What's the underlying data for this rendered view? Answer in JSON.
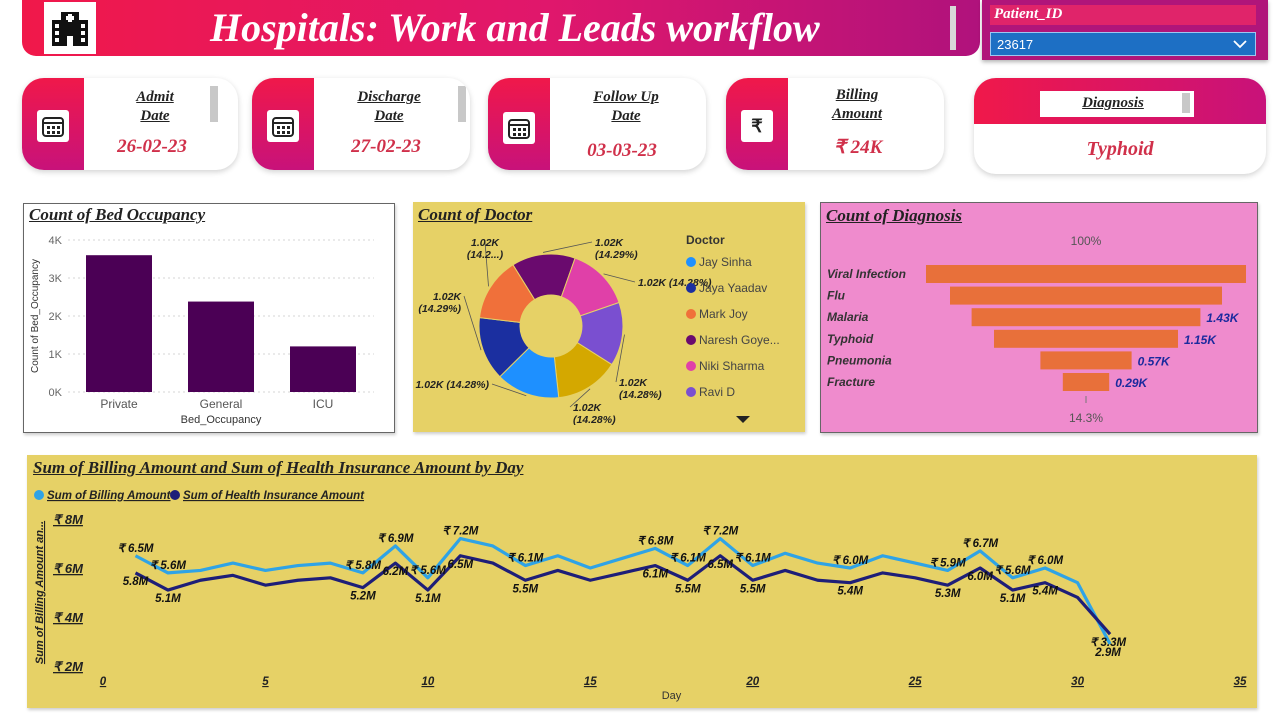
{
  "header": {
    "title": "Hospitals: Work and Leads workflow",
    "logo_icon": "hospital-icon"
  },
  "slicer": {
    "label": "Patient_ID",
    "value": "23617"
  },
  "kpis": [
    {
      "label_line1": "Admit",
      "label_line2": "Date",
      "value": "26-02-23",
      "icon": "calendar-icon"
    },
    {
      "label_line1": "Discharge",
      "label_line2": "Date",
      "value": "27-02-23",
      "icon": "calendar-icon"
    },
    {
      "label_line1": "Follow Up",
      "label_line2": "Date",
      "value": "03-03-23",
      "icon": "calendar-icon"
    },
    {
      "label_line1": "Billing",
      "label_line2": "Amount",
      "value": "₹ 24K",
      "icon": "rupee-icon",
      "icon_glyph": "₹"
    }
  ],
  "diagnosis_card": {
    "label": "Diagnosis",
    "value": "Typhoid"
  },
  "colors": {
    "accent": "#e8175d",
    "bar": "#4b0055",
    "funnel": "#e8703a",
    "billing": "#2fa3e6",
    "insurance": "#1e1e78",
    "yellow_panel": "#e6d166",
    "pink_panel": "#ef8bcd"
  },
  "chart_data": [
    {
      "type": "bar",
      "title": "Count of Bed Occupancy",
      "categories": [
        "Private",
        "General",
        "ICU"
      ],
      "values": [
        3600,
        2380,
        1200
      ],
      "xlabel": "Bed_Occupancy",
      "ylabel": "Count of Bed_Occupancy",
      "ylim": [
        0,
        4000
      ],
      "yticks": [
        "0K",
        "1K",
        "2K",
        "3K",
        "4K"
      ],
      "grid": true
    },
    {
      "type": "pie",
      "title": "Count of Doctor",
      "legend_title": "Doctor",
      "legend_position": "right",
      "series": [
        {
          "name": "Jay Sinha",
          "value": 1020,
          "color": "#1e90ff"
        },
        {
          "name": "Jaya Yaadav",
          "value": 1020,
          "color": "#1b2fa0"
        },
        {
          "name": "Mark Joy",
          "value": 1020,
          "color": "#f0703a"
        },
        {
          "name": "Naresh Goye...",
          "value": 1020,
          "color": "#6a0a6e"
        },
        {
          "name": "Niki Sharma",
          "value": 1020,
          "color": "#e040a8"
        },
        {
          "name": "Ravi D",
          "value": 1020,
          "color": "#7a4fd0"
        },
        {
          "name": "",
          "value": 1020,
          "color": "#d4a800"
        }
      ],
      "labels": [
        {
          "l1": "1.02K",
          "l2": "(14.29%)"
        },
        {
          "l1": "1.02K (14.28%)",
          "l2": ""
        },
        {
          "l1": "1.02K",
          "l2": "(14.28%)"
        },
        {
          "l1": "1.02K",
          "l2": "(14.28%)"
        },
        {
          "l1": "1.02K (14.28%)",
          "l2": ""
        },
        {
          "l1": "1.02K",
          "l2": "(14.29%)"
        },
        {
          "l1": "1.02K",
          "l2": "(14.2...)"
        }
      ]
    },
    {
      "type": "bar",
      "orientation": "funnel",
      "title": "Count of Diagnosis",
      "categories": [
        "Viral Infection",
        "Flu",
        "Malaria",
        "Typhoid",
        "Pneumonia",
        "Fracture"
      ],
      "values": [
        2000,
        1700,
        1430,
        1150,
        570,
        290
      ],
      "data_labels": [
        "",
        "",
        "1.43K",
        "1.15K",
        "0.57K",
        "0.29K"
      ],
      "top_label": "100%",
      "bottom_label": "14.3%"
    },
    {
      "type": "line",
      "title": "Sum of Billing Amount and Sum of Health Insurance Amount by Day",
      "xlabel": "Day",
      "ylabel": "Sum of Billing Amount an...",
      "xlim": [
        0,
        35
      ],
      "ylim": [
        2,
        8
      ],
      "xticks": [
        "0",
        "5",
        "10",
        "15",
        "20",
        "25",
        "30",
        "35"
      ],
      "yticks": [
        "₹ 2M",
        "₹ 4M",
        "₹ 6M",
        "₹ 8M"
      ],
      "legend_position": "top-left",
      "x": [
        1,
        2,
        3,
        4,
        5,
        6,
        7,
        8,
        9,
        10,
        11,
        12,
        13,
        14,
        15,
        16,
        17,
        18,
        19,
        20,
        21,
        22,
        23,
        24,
        25,
        26,
        27,
        28,
        29,
        30,
        31
      ],
      "series": [
        {
          "name": "Sum of Billing Amount",
          "color": "#2fa3e6",
          "values": [
            6.5,
            5.8,
            5.9,
            6.2,
            5.9,
            6.1,
            6.2,
            5.8,
            6.9,
            5.6,
            7.2,
            6.9,
            6.1,
            6.5,
            6.0,
            6.4,
            6.8,
            6.1,
            7.2,
            6.1,
            6.6,
            6.2,
            6.0,
            6.5,
            6.2,
            5.9,
            6.7,
            5.6,
            6.0,
            5.4,
            2.9
          ]
        },
        {
          "name": "Sum of Health Insurance Amount",
          "color": "#1e1e78",
          "values": [
            5.8,
            5.1,
            5.5,
            5.7,
            5.3,
            5.5,
            5.6,
            5.2,
            6.2,
            5.1,
            6.5,
            6.2,
            5.5,
            5.9,
            5.5,
            5.8,
            6.1,
            5.5,
            6.5,
            5.5,
            5.9,
            5.5,
            5.4,
            5.8,
            5.6,
            5.3,
            6.0,
            5.1,
            5.4,
            4.8,
            3.3
          ]
        }
      ],
      "data_labels": [
        {
          "text": "₹ 6.5M",
          "x": 1,
          "y": 6.5
        },
        {
          "text": "5.8M",
          "x": 1,
          "y": 5.8
        },
        {
          "text": "₹ 5.6M",
          "x": 2,
          "y": 5.8
        },
        {
          "text": "5.1M",
          "x": 2,
          "y": 5.1
        },
        {
          "text": "₹ 6.9M",
          "x": 9,
          "y": 6.9
        },
        {
          "text": "6.2M",
          "x": 9,
          "y": 6.2
        },
        {
          "text": "₹ 5.8M",
          "x": 8,
          "y": 5.8
        },
        {
          "text": "5.2M",
          "x": 8,
          "y": 5.2
        },
        {
          "text": "₹ 5.6M",
          "x": 10,
          "y": 5.6
        },
        {
          "text": "5.1M",
          "x": 10,
          "y": 5.1
        },
        {
          "text": "₹ 7.2M",
          "x": 11,
          "y": 7.2
        },
        {
          "text": "6.5M",
          "x": 11,
          "y": 6.5
        },
        {
          "text": "₹ 6.1M",
          "x": 13,
          "y": 6.1
        },
        {
          "text": "5.5M",
          "x": 13,
          "y": 5.5
        },
        {
          "text": "₹ 6.8M",
          "x": 17,
          "y": 6.8
        },
        {
          "text": "6.1M",
          "x": 17,
          "y": 6.1
        },
        {
          "text": "₹ 6.1M",
          "x": 18,
          "y": 6.1
        },
        {
          "text": "5.5M",
          "x": 18,
          "y": 5.5
        },
        {
          "text": "₹ 7.2M",
          "x": 19,
          "y": 7.2
        },
        {
          "text": "6.5M",
          "x": 19,
          "y": 6.5
        },
        {
          "text": "₹ 6.1M",
          "x": 20,
          "y": 6.1
        },
        {
          "text": "5.5M",
          "x": 20,
          "y": 5.5
        },
        {
          "text": "₹ 6.0M",
          "x": 23,
          "y": 6.0
        },
        {
          "text": "5.4M",
          "x": 23,
          "y": 5.4
        },
        {
          "text": "₹ 5.9M",
          "x": 26,
          "y": 5.9
        },
        {
          "text": "5.3M",
          "x": 26,
          "y": 5.3
        },
        {
          "text": "₹ 6.7M",
          "x": 27,
          "y": 6.7
        },
        {
          "text": "6.0M",
          "x": 27,
          "y": 6.0
        },
        {
          "text": "₹ 5.6M",
          "x": 28,
          "y": 5.6
        },
        {
          "text": "5.1M",
          "x": 28,
          "y": 5.1
        },
        {
          "text": "₹ 6.0M",
          "x": 29,
          "y": 6.0
        },
        {
          "text": "5.4M",
          "x": 29,
          "y": 5.4
        },
        {
          "text": "2.9M",
          "x": 31,
          "y": 2.9
        },
        {
          "text": "₹ 3.3M",
          "x": 31,
          "y": 3.3
        }
      ]
    }
  ]
}
